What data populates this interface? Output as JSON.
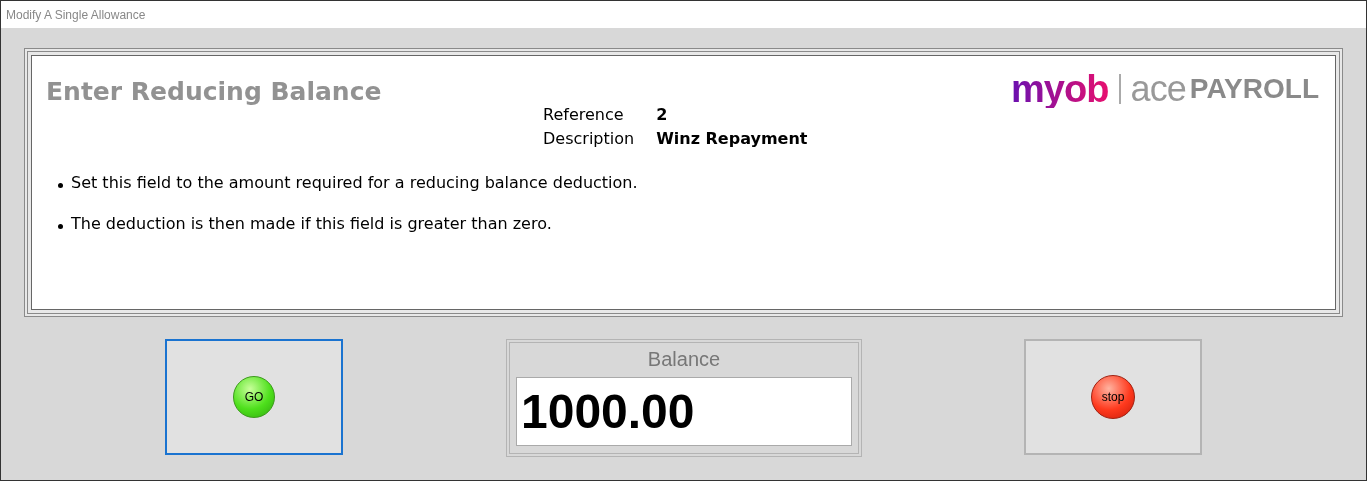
{
  "window": {
    "title": "Modify A Single Allowance"
  },
  "heading": "Enter Reducing Balance",
  "logo": {
    "brand": "myob",
    "product_light": "ace",
    "product_bold": "PAYROLL"
  },
  "details": [
    {
      "label": "Reference",
      "value": "2"
    },
    {
      "label": "Description",
      "value": "Winz Repayment"
    }
  ],
  "notes": [
    "Set this field to the amount required for a reducing balance deduction.",
    "The deduction is then made if this field is greater than zero."
  ],
  "buttons": [
    {
      "kind": "go",
      "label": "GO",
      "focused": true
    },
    {
      "kind": "stop",
      "label": "stop",
      "focused": false
    }
  ],
  "balance": {
    "label": "Balance",
    "value": "1000.00"
  }
}
